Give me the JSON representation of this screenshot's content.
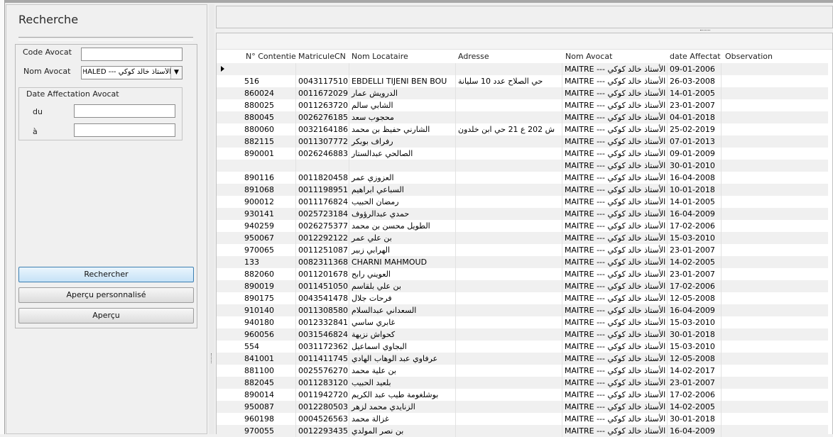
{
  "search": {
    "title": "Recherche",
    "code_avocat_label": "Code Avocat",
    "nom_avocat_label": "Nom Avocat",
    "nom_avocat_value": "الأستاذ خالد كوكي --- MAITRE KHALED",
    "date_group_label": "Date Affectation Avocat",
    "du_label": "du",
    "a_label": "à",
    "rechercher": "Rechercher",
    "apercu_perso": "Aperçu personnalisé",
    "apercu": "Aperçu"
  },
  "grid": {
    "headers": [
      "N° Contentie",
      "MatriculeCN",
      "Nom Locataire",
      "Adresse",
      "Nom Avocat",
      "date Affectat",
      "Observation"
    ],
    "avocat": "MAITRE --- الأستاذ خالد كوكي",
    "rows": [
      {
        "num": "",
        "mat": "",
        "nom": "",
        "adr": "",
        "date": "09-01-2006"
      },
      {
        "num": "516",
        "mat": "0043117510",
        "nom": "EBDELLI TIJENI BEN BOU",
        "adr": "حي الصلاح عدد 10 سليانة",
        "date": "26-03-2008"
      },
      {
        "num": "860024",
        "mat": "0011672029",
        "nom": "الدرويش عمار",
        "adr": "",
        "date": "14-01-2005"
      },
      {
        "num": "880025",
        "mat": "0011263720",
        "nom": "الشابي سالم",
        "adr": "",
        "date": "23-01-2007"
      },
      {
        "num": "880045",
        "mat": "0026276185",
        "nom": "محجوب سعد",
        "adr": "",
        "date": "04-01-2018"
      },
      {
        "num": "880060",
        "mat": "0032164186",
        "nom": "الشارني حفيظ بن محمد",
        "adr": "ش 202 ع 21 حي ابن خلدون",
        "date": "25-02-2019"
      },
      {
        "num": "882115",
        "mat": "0011307772",
        "nom": "رفراف بوبكر",
        "adr": "",
        "date": "07-01-2013"
      },
      {
        "num": "890001",
        "mat": "0026246883",
        "nom": "الصالحي عبدالستار",
        "adr": "",
        "date": "09-01-2009"
      },
      {
        "num": "",
        "mat": "",
        "nom": "",
        "adr": "",
        "date": "30-01-2010"
      },
      {
        "num": "890116",
        "mat": "0011820458",
        "nom": "العزوزي عمر",
        "adr": "",
        "date": "16-04-2008"
      },
      {
        "num": "891068",
        "mat": "0011198951",
        "nom": "السباعي ابراهيم",
        "adr": "",
        "date": "10-01-2018"
      },
      {
        "num": "900012",
        "mat": "0011176824",
        "nom": "رمضان الحبيب",
        "adr": "",
        "date": "14-01-2005"
      },
      {
        "num": "930141",
        "mat": "0025723184",
        "nom": "حمدي عبدالرؤوف",
        "adr": "",
        "date": "16-04-2009"
      },
      {
        "num": "940259",
        "mat": "0026275377",
        "nom": "الطويل محسن بن محمد",
        "adr": "",
        "date": "17-02-2006"
      },
      {
        "num": "950067",
        "mat": "0012292122",
        "nom": "بن علي عمر",
        "adr": "",
        "date": "15-03-2010"
      },
      {
        "num": "970065",
        "mat": "0011251087",
        "nom": "الهرابي زبير",
        "adr": "",
        "date": "23-01-2007"
      },
      {
        "num": "133",
        "mat": "0082311368",
        "nom": "CHARNI MAHMOUD",
        "adr": "",
        "date": "14-02-2005"
      },
      {
        "num": "882060",
        "mat": "0011201678",
        "nom": "العويني رابح",
        "adr": "",
        "date": "23-01-2007"
      },
      {
        "num": "890019",
        "mat": "0011451050",
        "nom": "بن علي بلقاسم",
        "adr": "",
        "date": "17-02-2006"
      },
      {
        "num": "890175",
        "mat": "0043541478",
        "nom": "فرحات جلال",
        "adr": "",
        "date": "12-05-2008"
      },
      {
        "num": "910140",
        "mat": "0011308580",
        "nom": "السعداني عبدالسلام",
        "adr": "",
        "date": "16-04-2009"
      },
      {
        "num": "940180",
        "mat": "0012332841",
        "nom": "غابري ساسي",
        "adr": "",
        "date": "15-03-2010"
      },
      {
        "num": "960056",
        "mat": "0031546824",
        "nom": "كحواش نزيهة",
        "adr": "",
        "date": "30-01-2018"
      },
      {
        "num": "554",
        "mat": "0031172362",
        "nom": "البجاوي اسماعيل",
        "adr": "",
        "date": "15-03-2010"
      },
      {
        "num": "841001",
        "mat": "0011411745",
        "nom": "عرفاوي عبد الوهاب الهادي",
        "adr": "",
        "date": "12-05-2008"
      },
      {
        "num": "881100",
        "mat": "0025576270",
        "nom": "بن علية محمد",
        "adr": "",
        "date": "14-02-2017"
      },
      {
        "num": "882045",
        "mat": "0011283120",
        "nom": "بلعيد الحبيب",
        "adr": "",
        "date": "23-01-2007"
      },
      {
        "num": "890014",
        "mat": "0011942720",
        "nom": "بوشلغومة طيب عبد الكريم",
        "adr": "",
        "date": "17-02-2006"
      },
      {
        "num": "950087",
        "mat": "0012280503",
        "nom": "الزنايدي محمد لزهر",
        "adr": "",
        "date": "14-02-2005"
      },
      {
        "num": "960198",
        "mat": "0004526563",
        "nom": "غزالة محمد",
        "adr": "",
        "date": "30-01-2018"
      },
      {
        "num": "970055",
        "mat": "0012293435",
        "nom": "بن نصر المولدي",
        "adr": "",
        "date": "16-04-2009"
      }
    ]
  }
}
